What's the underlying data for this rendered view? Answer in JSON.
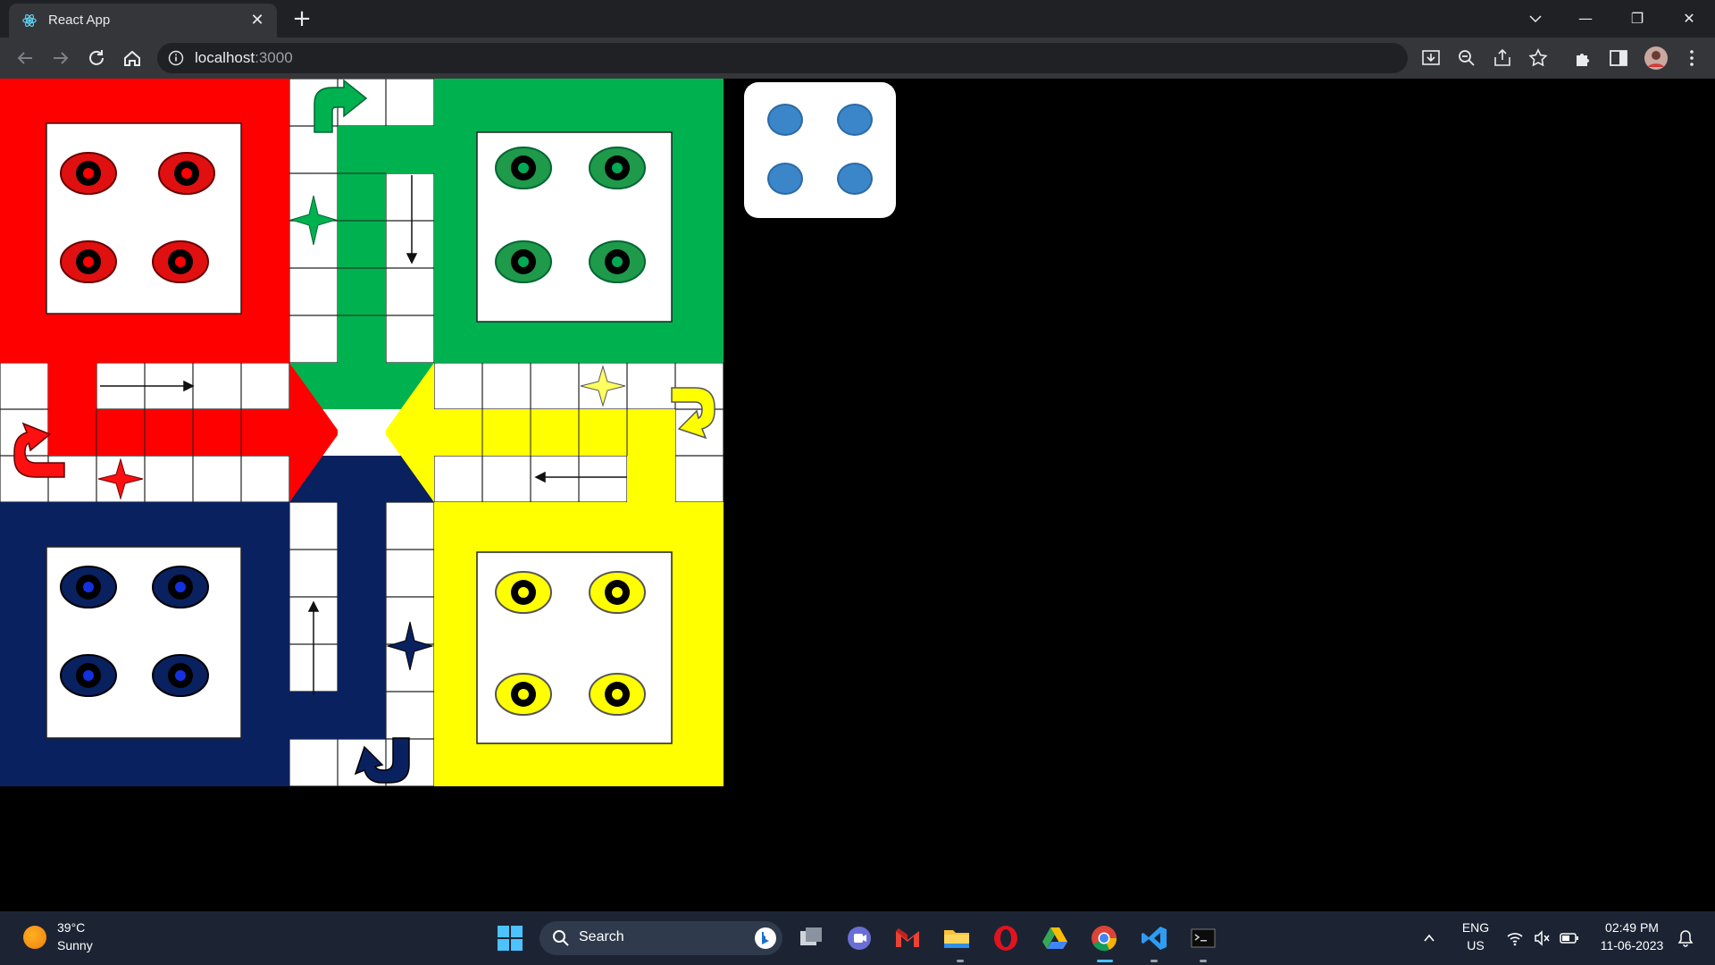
{
  "browser": {
    "tab_title": "React App",
    "new_tab_symbol": "+",
    "close_symbol": "✕",
    "url_host": "localhost",
    "url_port": ":3000",
    "window_controls": [
      "—",
      "❐",
      "✕"
    ]
  },
  "board": {
    "colors": {
      "red": "#ff0000",
      "green": "#00b14f",
      "yellow": "#ffff00",
      "blue": "#0a2160"
    },
    "tokens_per_home": 4
  },
  "dice": {
    "value": 4,
    "pip_color": "#3a86c8"
  },
  "taskbar": {
    "weather_temp": "39°C",
    "weather_desc": "Sunny",
    "search_label": "Search",
    "language": "ENG",
    "region": "US",
    "time": "02:49 PM",
    "date": "11-06-2023"
  }
}
